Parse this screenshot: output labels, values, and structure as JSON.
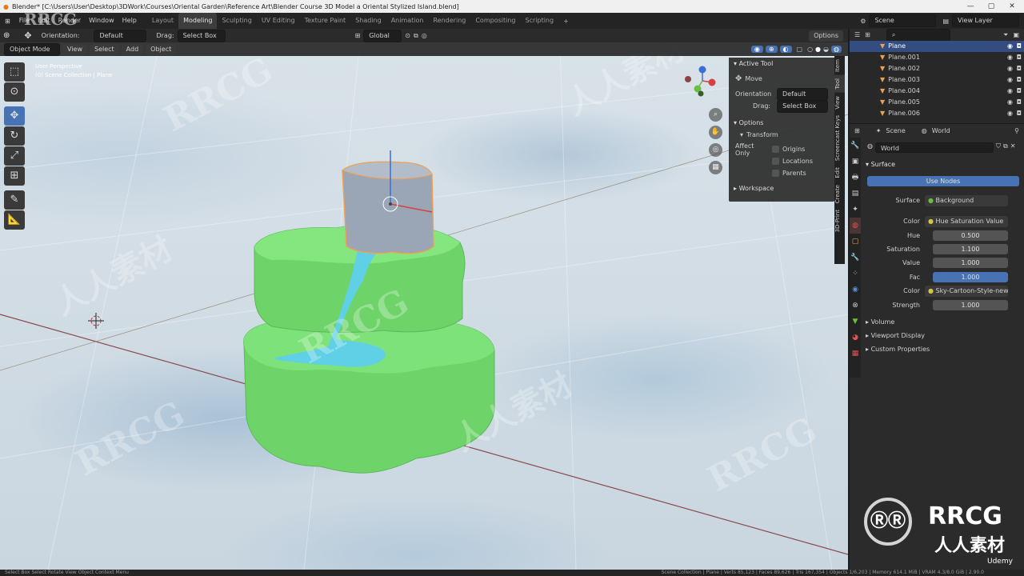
{
  "window": {
    "title": "Blender* [C:\\Users\\User\\Desktop\\3DWork\\Courses\\Oriental Garden\\Reference Art\\Blender Course 3D Model a Oriental Stylized Island.blend]"
  },
  "menus": [
    "File",
    "Edit",
    "Render",
    "Window",
    "Help"
  ],
  "workspaces": [
    "Layout",
    "Modeling",
    "Sculpting",
    "UV Editing",
    "Texture Paint",
    "Shading",
    "Animation",
    "Rendering",
    "Compositing",
    "Scripting"
  ],
  "active_workspace": "Modeling",
  "scene_name": "Scene",
  "view_layer": "View Layer",
  "tool_header": {
    "orientation_label": "Orientation:",
    "orientation_value": "Default",
    "drag_label": "Drag:",
    "drag_value": "Select Box",
    "transform_orientation": "Global",
    "options": "Options"
  },
  "viewport_header": {
    "mode": "Object Mode",
    "view": "View",
    "select": "Select",
    "add": "Add",
    "object": "Object"
  },
  "viewport_overlay": {
    "line1": "User Perspective",
    "line2": "(0) Scene Collection | Plane"
  },
  "npanel": {
    "active_tool": "Active Tool",
    "move": "Move",
    "orientation_label": "Orientation",
    "orientation_value": "Default",
    "drag_label": "Drag:",
    "drag_value": "Select Box",
    "options": "Options",
    "transform": "Transform",
    "affect_only": "Affect Only",
    "origins": "Origins",
    "locations": "Locations",
    "parents": "Parents",
    "workspace": "Workspace",
    "tabs": [
      "Item",
      "Tool",
      "View",
      "Screencast Keys",
      "Edit",
      "Create",
      "3D-Print"
    ]
  },
  "outliner": {
    "items": [
      "Plane",
      "Plane.001",
      "Plane.002",
      "Plane.003",
      "Plane.004",
      "Plane.005",
      "Plane.006"
    ],
    "selected": "Plane"
  },
  "properties": {
    "breadcrumb_scene": "Scene",
    "breadcrumb_world": "World",
    "world_name": "World",
    "surface_section": "Surface",
    "use_nodes": "Use Nodes",
    "surface_label": "Surface",
    "surface_value": "Background",
    "color_label": "Color",
    "color_value": "Hue Saturation Value",
    "hue_label": "Hue",
    "hue_value": "0.500",
    "saturation_label": "Saturation",
    "saturation_value": "1.100",
    "value_label": "Value",
    "value_value": "1.000",
    "fac_label": "Fac",
    "fac_value": "1.000",
    "color2_label": "Color",
    "color2_value": "Sky-Cartoon-Style-new.hdr",
    "strength_label": "Strength",
    "strength_value": "1.000",
    "volume": "Volume",
    "viewport_display": "Viewport Display",
    "custom_properties": "Custom Properties"
  },
  "statusbar": {
    "left": "Select        Box Select        Rotate View        Object Context Menu",
    "right": "Scene Collection | Plane | Verts 85,123 | Faces 89,626 | Tris 167,354 | Objects 1/6,203 | Memory 614.1 MiB | VRAM 4.3/8.0 GiB | 2.90.0"
  },
  "watermarks": {
    "brand": "RRCG",
    "cn": "人人素材",
    "udemy": "Udemy"
  },
  "colors": {
    "accent": "#4772b3",
    "island_green": "#6ed46a",
    "water": "#5fd0e6",
    "selection": "#f0a050"
  }
}
